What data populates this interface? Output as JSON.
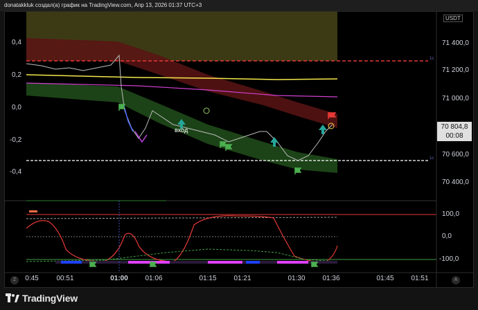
{
  "header": {
    "title": "donatakkluk создал(а) график на TradingView.com, Апр 13, 2026 01:37 UTC+3"
  },
  "axis": {
    "currency": "USDT",
    "price_ticks": [
      "71 400,0",
      "71 200,0",
      "71 000,0",
      "70 600,0",
      "70 400,0"
    ],
    "left_ticks": [
      "0,4",
      "0,2",
      "0,0",
      "-0,2",
      "-0,4"
    ],
    "osc_ticks": [
      "100,0",
      "0,0",
      "-100,0"
    ]
  },
  "current_price": {
    "value": "70 804,8",
    "countdown": "00:08"
  },
  "annotation": {
    "text": "вход"
  },
  "time_ticks": [
    {
      "label": "0:45",
      "bold": false
    },
    {
      "label": "00:51",
      "bold": false
    },
    {
      "label": "01:00",
      "bold": true
    },
    {
      "label": "01:06",
      "bold": false
    },
    {
      "label": "01:15",
      "bold": false
    },
    {
      "label": "01:21",
      "bold": false
    },
    {
      "label": "01:30",
      "bold": false
    },
    {
      "label": "01:36",
      "bold": false
    },
    {
      "label": "01:45",
      "bold": false
    },
    {
      "label": "01:51",
      "bold": false
    }
  ],
  "buttons": {
    "zoom_left": "Z",
    "auto_right": "A"
  },
  "brand": {
    "name": "TradingView"
  },
  "colors": {
    "accent_red": "#e53935",
    "band_green": "#2e7d32",
    "band_red": "#8e2424",
    "yellow": "#f5e84a",
    "magenta": "#d040d0"
  }
}
